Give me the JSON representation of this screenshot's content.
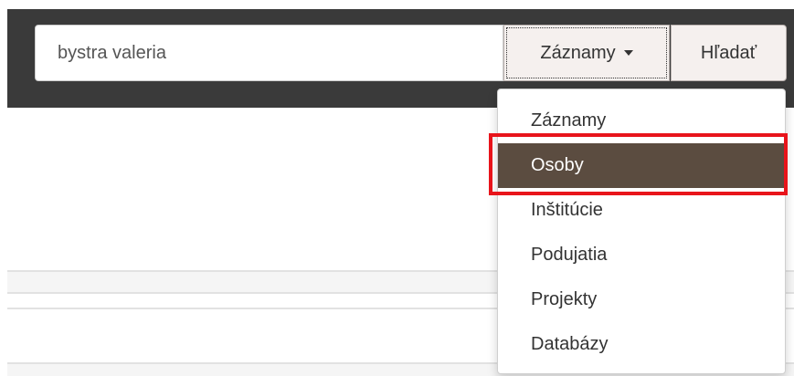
{
  "search": {
    "value": "bystra valeria",
    "scope_label": "Záznamy",
    "submit_label": "Hľadať"
  },
  "menu": {
    "items": [
      {
        "label": "Záznamy"
      },
      {
        "label": "Osoby",
        "active": true
      },
      {
        "label": "Inštitúcie"
      },
      {
        "label": "Podujatia"
      },
      {
        "label": "Projekty"
      },
      {
        "label": "Databázy"
      }
    ]
  },
  "colors": {
    "header_bg": "#3a3a3a",
    "active_item_bg": "#5b4c40",
    "highlight_border": "#e8141b"
  }
}
